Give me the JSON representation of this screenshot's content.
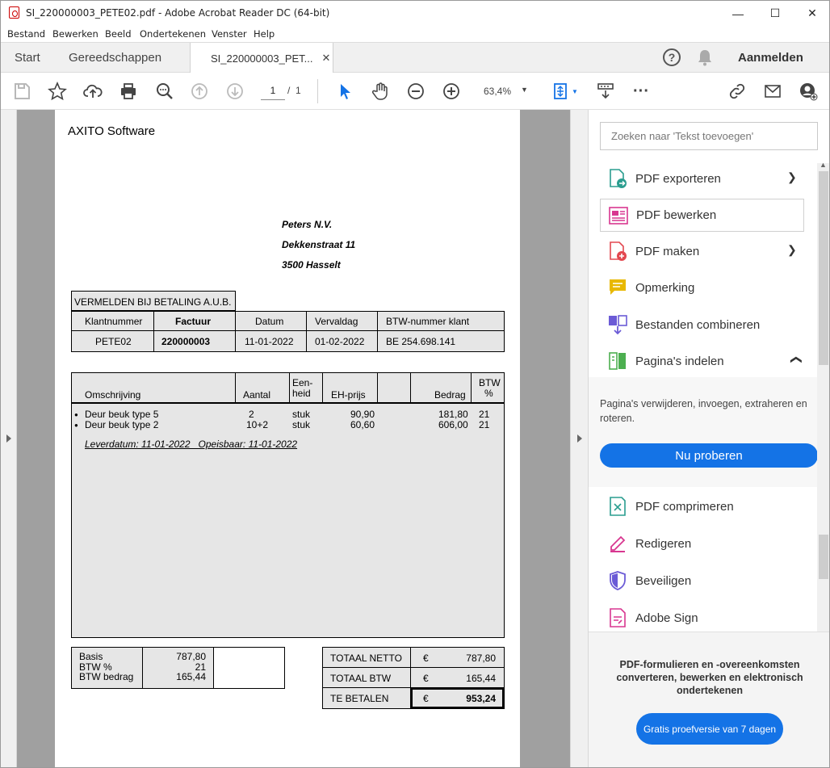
{
  "window": {
    "title": "SI_220000003_PETE02.pdf - Adobe Acrobat Reader DC (64-bit)",
    "minimize": "—",
    "maximize": "☐",
    "close": "✕"
  },
  "menu": [
    "Bestand",
    "Bewerken",
    "Beeld",
    "Ondertekenen",
    "Venster",
    "Help"
  ],
  "tabs": {
    "start": "Start",
    "tools": "Gereedschappen",
    "doc": "SI_220000003_PET...",
    "signin": "Aanmelden"
  },
  "toolbar": {
    "page_current": "1",
    "page_sep": "/",
    "page_total": "1",
    "zoom": "63,4%"
  },
  "invoice": {
    "company": "AXITO Software",
    "addr": [
      "Peters N.V.",
      "Dekkenstraat 11",
      "3500 Hasselt"
    ],
    "notice": "VERMELDEN BIJ BETALING A.U.B.",
    "hdr": [
      "Klantnummer",
      "Factuur",
      "Datum",
      "Vervaldag",
      "BTW-nummer klant"
    ],
    "vals": [
      "PETE02",
      "220000003",
      "11-01-2022",
      "01-02-2022",
      "BE 254.698.141"
    ],
    "cols": {
      "omschrijving": "Omschrijving",
      "aantal": "Aantal",
      "eenheid1": "Een-",
      "eenheid2": "heid",
      "ehprijs": "EH-prijs",
      "bedrag": "Bedrag",
      "btw1": "BTW",
      "btw2": "%"
    },
    "lines": [
      {
        "desc": "Deur beuk type 5",
        "qty": "2",
        "unit": "stuk",
        "price": "90,90",
        "amount": "181,80",
        "vat": "21"
      },
      {
        "desc": "Deur beuk type 2",
        "qty": "10+2",
        "unit": "stuk",
        "price": "60,60",
        "amount": "606,00",
        "vat": "21"
      }
    ],
    "delivery": "Leverdatum: 11-01-2022   Opeisbaar: 11-01-2022",
    "basis_labels": [
      "Basis",
      "BTW %",
      "BTW bedrag"
    ],
    "basis_vals": [
      "787,80",
      "21",
      "165,44"
    ],
    "totals": [
      {
        "label": "TOTAAL NETTO",
        "cur": "€",
        "val": "787,80"
      },
      {
        "label": "TOTAAL BTW",
        "cur": "€",
        "val": "165,44"
      },
      {
        "label": "TE BETALEN",
        "cur": "€",
        "val": "953,24"
      }
    ]
  },
  "panel": {
    "search_placeholder": "Zoeken naar 'Tekst toevoegen'",
    "items": [
      "PDF exporteren",
      "PDF bewerken",
      "PDF maken",
      "Opmerking",
      "Bestanden combineren",
      "Pagina's indelen"
    ],
    "organize_desc": "Pagina's verwijderen, invoegen, extraheren en roteren.",
    "try_now": "Nu proberen",
    "items2": [
      "PDF comprimeren",
      "Redigeren",
      "Beveiligen",
      "Adobe Sign"
    ],
    "promo": "PDF-formulieren en -overeenkomsten converteren, bewerken en elektronisch ondertekenen",
    "trial": "Gratis proefversie van 7 dagen",
    "colors": {
      "accent": "#1473e6",
      "export": "#2a9d8f",
      "edit": "#d83790",
      "create": "#e34850",
      "comment": "#e8b800",
      "combine": "#6b5bd6",
      "organize": "#4caf50"
    }
  }
}
